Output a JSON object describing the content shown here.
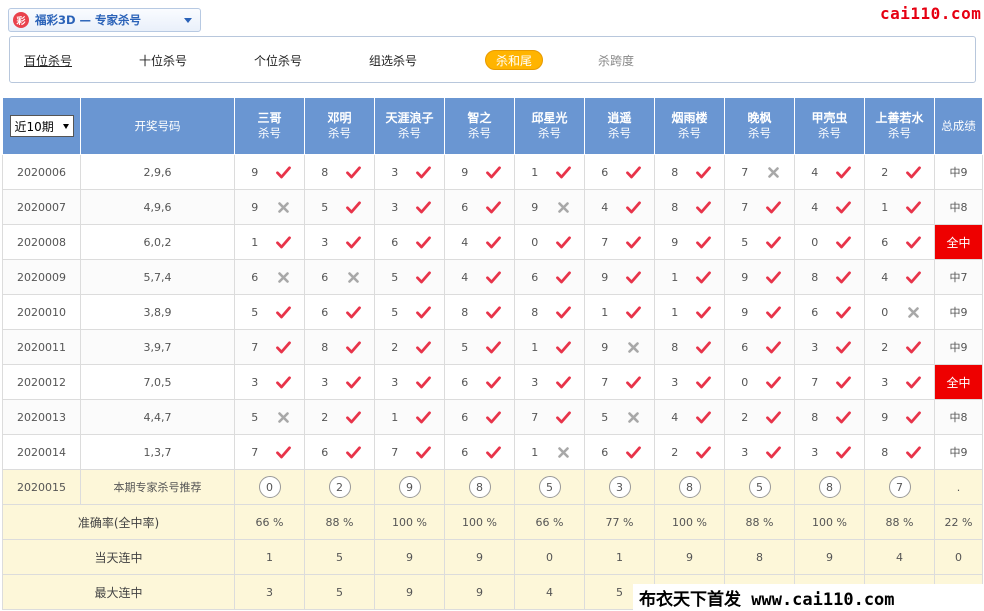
{
  "header": {
    "logo_glyph": "彩",
    "title": "福彩3D — 专家杀号",
    "brand": "cai110.com"
  },
  "tabs": [
    {
      "label": "百位杀号",
      "state": "active"
    },
    {
      "label": "十位杀号",
      "state": "normal"
    },
    {
      "label": "个位杀号",
      "state": "normal"
    },
    {
      "label": "组选杀号",
      "state": "normal"
    },
    {
      "label": "杀和尾",
      "state": "highlight"
    },
    {
      "label": "杀跨度",
      "state": "dim"
    }
  ],
  "table": {
    "period_select": "近10期",
    "draw_header": "开奖号码",
    "total_header": "总成绩",
    "sub_label": "杀号",
    "experts": [
      "三哥",
      "邓明",
      "天涯浪子",
      "智之",
      "邱星光",
      "逍遥",
      "烟雨楼",
      "晚枫",
      "甲壳虫",
      "上善若水"
    ],
    "rows": [
      {
        "issue": "2020006",
        "draw": "2,9,6",
        "picks": [
          [
            "9",
            1
          ],
          [
            "8",
            1
          ],
          [
            "3",
            1
          ],
          [
            "9",
            1
          ],
          [
            "1",
            1
          ],
          [
            "6",
            1
          ],
          [
            "8",
            1
          ],
          [
            "7",
            0
          ],
          [
            "4",
            1
          ],
          [
            "2",
            1
          ]
        ],
        "total": "中9",
        "full": false
      },
      {
        "issue": "2020007",
        "draw": "4,9,6",
        "picks": [
          [
            "9",
            0
          ],
          [
            "5",
            1
          ],
          [
            "3",
            1
          ],
          [
            "6",
            1
          ],
          [
            "9",
            0
          ],
          [
            "4",
            1
          ],
          [
            "8",
            1
          ],
          [
            "7",
            1
          ],
          [
            "4",
            1
          ],
          [
            "1",
            1
          ]
        ],
        "total": "中8",
        "full": false
      },
      {
        "issue": "2020008",
        "draw": "6,0,2",
        "picks": [
          [
            "1",
            1
          ],
          [
            "3",
            1
          ],
          [
            "6",
            1
          ],
          [
            "4",
            1
          ],
          [
            "0",
            1
          ],
          [
            "7",
            1
          ],
          [
            "9",
            1
          ],
          [
            "5",
            1
          ],
          [
            "0",
            1
          ],
          [
            "6",
            1
          ]
        ],
        "total": "全中",
        "full": true
      },
      {
        "issue": "2020009",
        "draw": "5,7,4",
        "picks": [
          [
            "6",
            0
          ],
          [
            "6",
            0
          ],
          [
            "5",
            1
          ],
          [
            "4",
            1
          ],
          [
            "6",
            1
          ],
          [
            "9",
            1
          ],
          [
            "1",
            1
          ],
          [
            "9",
            1
          ],
          [
            "8",
            1
          ],
          [
            "4",
            1
          ]
        ],
        "total": "中7",
        "full": false
      },
      {
        "issue": "2020010",
        "draw": "3,8,9",
        "picks": [
          [
            "5",
            1
          ],
          [
            "6",
            1
          ],
          [
            "5",
            1
          ],
          [
            "8",
            1
          ],
          [
            "8",
            1
          ],
          [
            "1",
            1
          ],
          [
            "1",
            1
          ],
          [
            "9",
            1
          ],
          [
            "6",
            1
          ],
          [
            "0",
            0
          ]
        ],
        "total": "中9",
        "full": false
      },
      {
        "issue": "2020011",
        "draw": "3,9,7",
        "picks": [
          [
            "7",
            1
          ],
          [
            "8",
            1
          ],
          [
            "2",
            1
          ],
          [
            "5",
            1
          ],
          [
            "1",
            1
          ],
          [
            "9",
            0
          ],
          [
            "8",
            1
          ],
          [
            "6",
            1
          ],
          [
            "3",
            1
          ],
          [
            "2",
            1
          ]
        ],
        "total": "中9",
        "full": false
      },
      {
        "issue": "2020012",
        "draw": "7,0,5",
        "picks": [
          [
            "3",
            1
          ],
          [
            "3",
            1
          ],
          [
            "3",
            1
          ],
          [
            "6",
            1
          ],
          [
            "3",
            1
          ],
          [
            "7",
            1
          ],
          [
            "3",
            1
          ],
          [
            "0",
            1
          ],
          [
            "7",
            1
          ],
          [
            "3",
            1
          ]
        ],
        "total": "全中",
        "full": true
      },
      {
        "issue": "2020013",
        "draw": "4,4,7",
        "picks": [
          [
            "5",
            0
          ],
          [
            "2",
            1
          ],
          [
            "1",
            1
          ],
          [
            "6",
            1
          ],
          [
            "7",
            1
          ],
          [
            "5",
            0
          ],
          [
            "4",
            1
          ],
          [
            "2",
            1
          ],
          [
            "8",
            1
          ],
          [
            "9",
            1
          ]
        ],
        "total": "中8",
        "full": false
      },
      {
        "issue": "2020014",
        "draw": "1,3,7",
        "picks": [
          [
            "7",
            1
          ],
          [
            "6",
            1
          ],
          [
            "7",
            1
          ],
          [
            "6",
            1
          ],
          [
            "1",
            0
          ],
          [
            "6",
            1
          ],
          [
            "2",
            1
          ],
          [
            "3",
            1
          ],
          [
            "3",
            1
          ],
          [
            "8",
            1
          ]
        ],
        "total": "中9",
        "full": false
      }
    ],
    "recommend": {
      "issue": "2020015",
      "label": "本期专家杀号推荐",
      "numbers": [
        "0",
        "2",
        "9",
        "8",
        "5",
        "3",
        "8",
        "5",
        "8",
        "7"
      ],
      "total": "."
    },
    "stats": [
      {
        "label": "准确率(全中率)",
        "values": [
          "66 %",
          "88 %",
          "100 %",
          "100 %",
          "66 %",
          "77 %",
          "100 %",
          "88 %",
          "100 %",
          "88 %"
        ],
        "total": "22 %"
      },
      {
        "label": "当天连中",
        "values": [
          "1",
          "5",
          "9",
          "9",
          "0",
          "1",
          "9",
          "8",
          "9",
          "4"
        ],
        "total": "0"
      },
      {
        "label": "最大连中",
        "values": [
          "3",
          "5",
          "9",
          "9",
          "4",
          "5",
          "",
          "",
          "",
          ""
        ],
        "total": ""
      }
    ]
  },
  "watermark": "布衣天下首发 www.cai110.com",
  "colors": {
    "header_bg": "#6a96d2",
    "hit": "#e8344a",
    "miss": "#a8a8a8",
    "full_hit": "#ee0000",
    "recommend_bg": "#fdf7d9",
    "tab_highlight": "#ffb400"
  },
  "icons": {
    "hit": "check-icon",
    "miss": "cross-icon"
  }
}
